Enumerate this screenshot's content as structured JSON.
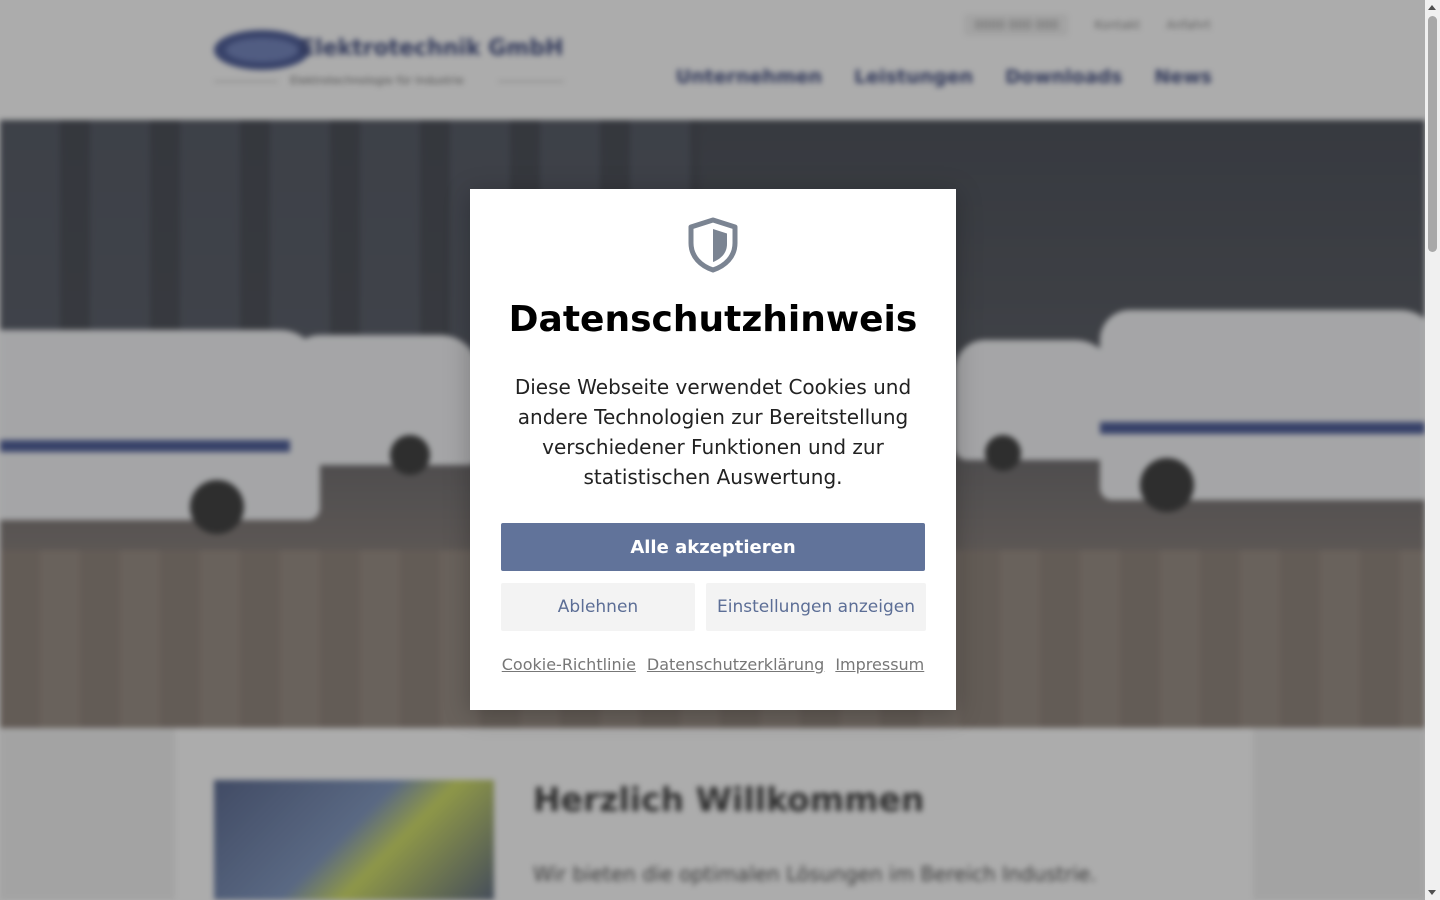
{
  "header": {
    "logo_text": "Elektrotechnik GmbH",
    "logo_subtitle": "Elektrotechnologie für Industrie",
    "topbar": [
      "0000 000 000",
      "Kontakt",
      "Anfahrt"
    ],
    "nav": [
      "Unternehmen",
      "Leistungen",
      "Downloads",
      "News"
    ]
  },
  "content": {
    "welcome_title": "Herzlich Willkommen",
    "tagline": "Wir bieten die optimalen Lösungen im Bereich Industrie."
  },
  "cookie_modal": {
    "icon": "shield-icon",
    "title": "Datenschutzhinweis",
    "message": "Diese Webseite verwendet Cookies und andere Technologien zur Bereitstellung verschiedener Funktionen und zur statistischen Auswertung.",
    "accept_label": "Alle akzeptieren",
    "decline_label": "Ablehnen",
    "settings_label": "Einstellungen anzeigen",
    "links": [
      "Cookie-Richtlinie",
      "Datenschutzerklärung",
      "Impressum"
    ]
  },
  "colors": {
    "accent": "#61739a",
    "secondary_text": "#5c6e96",
    "brand_blue": "#2c3f86"
  }
}
